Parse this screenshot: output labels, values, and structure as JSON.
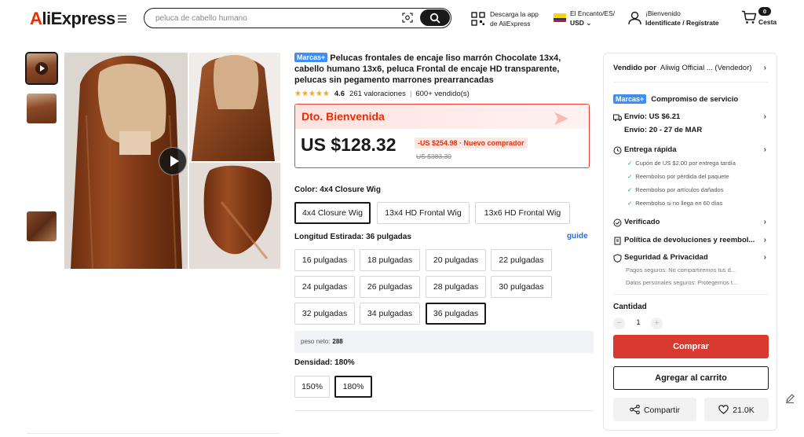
{
  "header": {
    "logo_main": "AliExpress",
    "search_placeholder": "peluca de cabello humano",
    "app_line1": "Descarga la app",
    "app_line2": "de AliExpress",
    "region_line1": "El Encanto/ES/",
    "region_currency": "USD",
    "account_line1": "¡Bienvenido",
    "account_line2": "Identifícate / Regístrate",
    "cart_count": "0",
    "cart_label": "Cesta"
  },
  "product": {
    "brand_tag": "Marcas+",
    "title": "Pelucas frontales de encaje liso marrón Chocolate 13x4, cabello humano 13x6, peluca Frontal de encaje HD transparente, pelucas sin pegamento marrones prearrancadas",
    "stars": "★★★★★",
    "rating": "4.6",
    "reviews": "261 valoraciones",
    "sold": "600+ vendido(s)"
  },
  "price": {
    "banner": "Dto. Bienvenida",
    "current": "US $128.32",
    "discount": "-US $254.98 · Nuevo comprador",
    "original": "US $383.30"
  },
  "color": {
    "label": "Color: 4x4 Closure Wig",
    "options": [
      "4x4 Closure Wig",
      "13x4 HD Frontal Wig",
      "13x6 HD Frontal Wig"
    ],
    "selected_index": 0
  },
  "length": {
    "label": "Longitud Estirada: 36 pulgadas",
    "guide": "guide",
    "options": [
      "16 pulgadas",
      "18 pulgadas",
      "20 pulgadas",
      "22 pulgadas",
      "24 pulgadas",
      "26 pulgadas",
      "28 pulgadas",
      "30 pulgadas",
      "32 pulgadas",
      "34 pulgadas",
      "36 pulgadas"
    ],
    "selected_index": 10
  },
  "net_weight": {
    "label": "peso neto:",
    "value": "288"
  },
  "density": {
    "label": "Densidad: 180%",
    "options": [
      "150%",
      "180%"
    ],
    "selected_index": 1
  },
  "panel": {
    "seller_label": "Vendido por",
    "seller_name": "Aliwig Official ... (Vendedor)",
    "brand_tag": "Marcas+",
    "commitment": "Compromiso de servicio",
    "shipping_cost": "Envío: US $6.21",
    "shipping_date": "Envío: 20 - 27 de MAR",
    "fast_delivery": "Entrega rápida",
    "fast_items": [
      "Cupón de US $2.00 por entrega tardía",
      "Reembolso por pérdida del paquete",
      "Reembolso por artículos dañados",
      "Reembolso si no llega en 60 días"
    ],
    "verified": "Verificado",
    "returns": "Política de devoluciones y reembol...",
    "security": "Seguridad & Privacidad",
    "security_items": [
      "Pagos seguros: No compartiremos tus d...",
      "Datos personales seguros: Protegemos t..."
    ],
    "quantity_label": "Cantidad",
    "quantity_value": "1",
    "buy_label": "Comprar",
    "cart_label": "Agregar al carrito",
    "share_label": "Compartir",
    "likes": "21.0K"
  },
  "colors": {
    "brand_red": "#e62e04",
    "buy_button": "#d93a2f",
    "brand_tag_blue": "#3f8cf3",
    "star": "#f5a623",
    "link_blue": "#2b6ad8"
  },
  "icons": [
    "menu-icon",
    "camera-icon",
    "search-icon",
    "qr-icon",
    "flag-icon",
    "user-icon",
    "cart-icon",
    "play-icon",
    "truck-icon",
    "clock-icon",
    "shield-icon",
    "return-icon",
    "lock-icon",
    "share-icon",
    "heart-icon",
    "edit-icon"
  ]
}
